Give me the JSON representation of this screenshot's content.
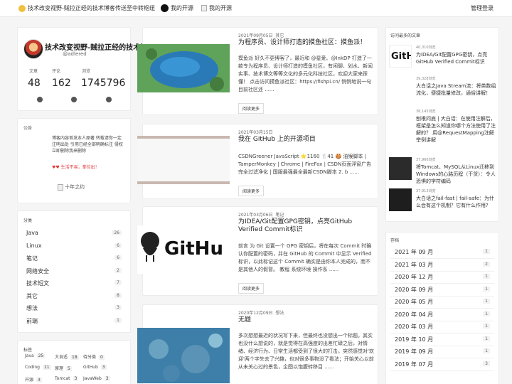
{
  "nav": {
    "site_name": "技术改变视野-贼拉正经的技术博客",
    "item2": "传送至中转枢纽",
    "item3": "我的开源",
    "item4": "我的开源",
    "admin": "管理登录"
  },
  "profile": {
    "title": "技术改变视野-贼拉正经的技术博客",
    "user": "@adlered",
    "stats": [
      {
        "label": "文章",
        "value": "48"
      },
      {
        "label": "评论",
        "value": "162"
      },
      {
        "label": "浏览",
        "value": "1745796"
      }
    ]
  },
  "notice": {
    "heading": "公告",
    "text": "博客内容首发本人原著 转载请你一定注明出处 引用已经全部明确标注 侵权立即删除我来删除",
    "red_text": "♥♥ 生活不易，拳捡出！",
    "image_alt": "十年之约"
  },
  "categories": {
    "heading": "分类",
    "items": [
      {
        "name": "Java",
        "count": "26"
      },
      {
        "name": "Linux",
        "count": "6"
      },
      {
        "name": "笔记",
        "count": "6"
      },
      {
        "name": "网络安全",
        "count": "2"
      },
      {
        "name": "技术短文",
        "count": "7"
      },
      {
        "name": "其它",
        "count": "8"
      },
      {
        "name": "想法",
        "count": "3"
      },
      {
        "name": "前端",
        "count": "1"
      }
    ]
  },
  "tags": {
    "heading": "标签",
    "items": [
      {
        "name": "Java",
        "count": "25"
      },
      {
        "name": "大自适",
        "count": "18"
      },
      {
        "name": "待分类",
        "count": "0"
      },
      {
        "name": "Coding",
        "count": "11"
      },
      {
        "name": "原理",
        "count": "5"
      },
      {
        "name": "GitHub",
        "count": "3"
      },
      {
        "name": "开源",
        "count": "3"
      },
      {
        "name": "Tomcat",
        "count": "3"
      },
      {
        "name": "JavaWeb",
        "count": "3"
      }
    ]
  },
  "articles": [
    {
      "date": "2021年09月05日",
      "category": "其它",
      "title": "为程序员、设计师打造的摸鱼社区：摸鱼派！",
      "excerpt": "摸鱼派 好久不更博客了，最近和 @星爱、@InkDP 打造了一款专为程序员、设计师打造的摸鱼社区，有闲聊、划水、新闻实事、技术博文等等文化的多元化科技社区，欢迎大家来踩懂！ 点击访问摸鱼派社区：https://fishpi.cn/ 悄悄地说一句 目前社区还 ......",
      "read": "阅读更多"
    },
    {
      "date": "2021年03月15日",
      "category": "",
      "title": "我在 GitHub 上的开源项目",
      "excerpt": "CSDNGreener JavaScript ⭐1160 🍴41 🍪 油猴脚本 | TamperMonkey | Chrome | FireFox | CSDN页面浮窗广告完全过滤净化 | 国服最强最全最新CSDN脚本 2. b ......",
      "read": "阅读更多"
    },
    {
      "date": "2021年03月06日",
      "category": "笔记",
      "title": "为IDEA/Git配置GPG密钥，点亮GitHub Verified Commit标识",
      "excerpt": "前言 为 Git 设置一个 GPG 密钥后，将在每次 Commit 时确认你配置的密码，并在 GitHub 的 Commit 中显示 Verified 标识，以此标记这个 Commit 确实是由你本人完成的，而不是其他人的假冒。 教程 系统环境 操作系 ......",
      "read": "阅读更多",
      "image_text": "GitHu"
    },
    {
      "date": "2020年12月09日",
      "category": "想法",
      "title": "无题",
      "excerpt": "多次想想最近的状况写下来，但最终也没想出一个标题。其实也没什么想说的，就是觉得在高强度的出差忙碌之后，对情绪、经济行为、日常生活都受到了很大的打击。突然感觉对'欢迎'两个字失去了兴趣，也对很多事物没了看法；开始关心以前从未关心过的景色，企图以饱腹转移目 ......"
    }
  ],
  "popular": {
    "heading": "访问最多的文章",
    "items": [
      {
        "views": "40,310浏览",
        "title": "为IDEA/Git配置GPG密钥，点亮GitHub Verified Commit标识",
        "thumb_text": "GitH"
      },
      {
        "views": "39,328浏览",
        "title": "大白话之Java Stream流：将类数组流化，便捷批量修改，通俗讲解！"
      },
      {
        "views": "38,145浏览",
        "title": "刨根问底 | 大白话：在使用注解后，框架是怎么知道你哪个方法使用了注解的？ 用@RequestMapping注解举例讲解"
      },
      {
        "views": "37,966浏览",
        "title": "将Tomcat、MySQL从Linux迁移到Windows的心路历程（干货）：令人恐惧的字符编码"
      },
      {
        "views": "37,913浏览",
        "title": "大白话之fail-fast | fail-safe：为什么会有这个机制？它有什么作用?"
      }
    ]
  },
  "archive": {
    "heading": "存档",
    "items": [
      {
        "month": "2021 年 09 月",
        "count": "1"
      },
      {
        "month": "2021 年 03 月",
        "count": "2"
      },
      {
        "month": "2020 年 12 月",
        "count": "1"
      },
      {
        "month": "2020 年 09 月",
        "count": "1"
      },
      {
        "month": "2020 年 05 月",
        "count": "1"
      },
      {
        "month": "2020 年 04 月",
        "count": "1"
      },
      {
        "month": "2020 年 03 月",
        "count": "1"
      },
      {
        "month": "2019 年 10 月",
        "count": "1"
      },
      {
        "month": "2019 年 09 月",
        "count": "1"
      },
      {
        "month": "2019 年 07 月",
        "count": "3"
      }
    ]
  },
  "colors": {
    "accent": "#e4393c",
    "bg": "#f5f5f5"
  }
}
